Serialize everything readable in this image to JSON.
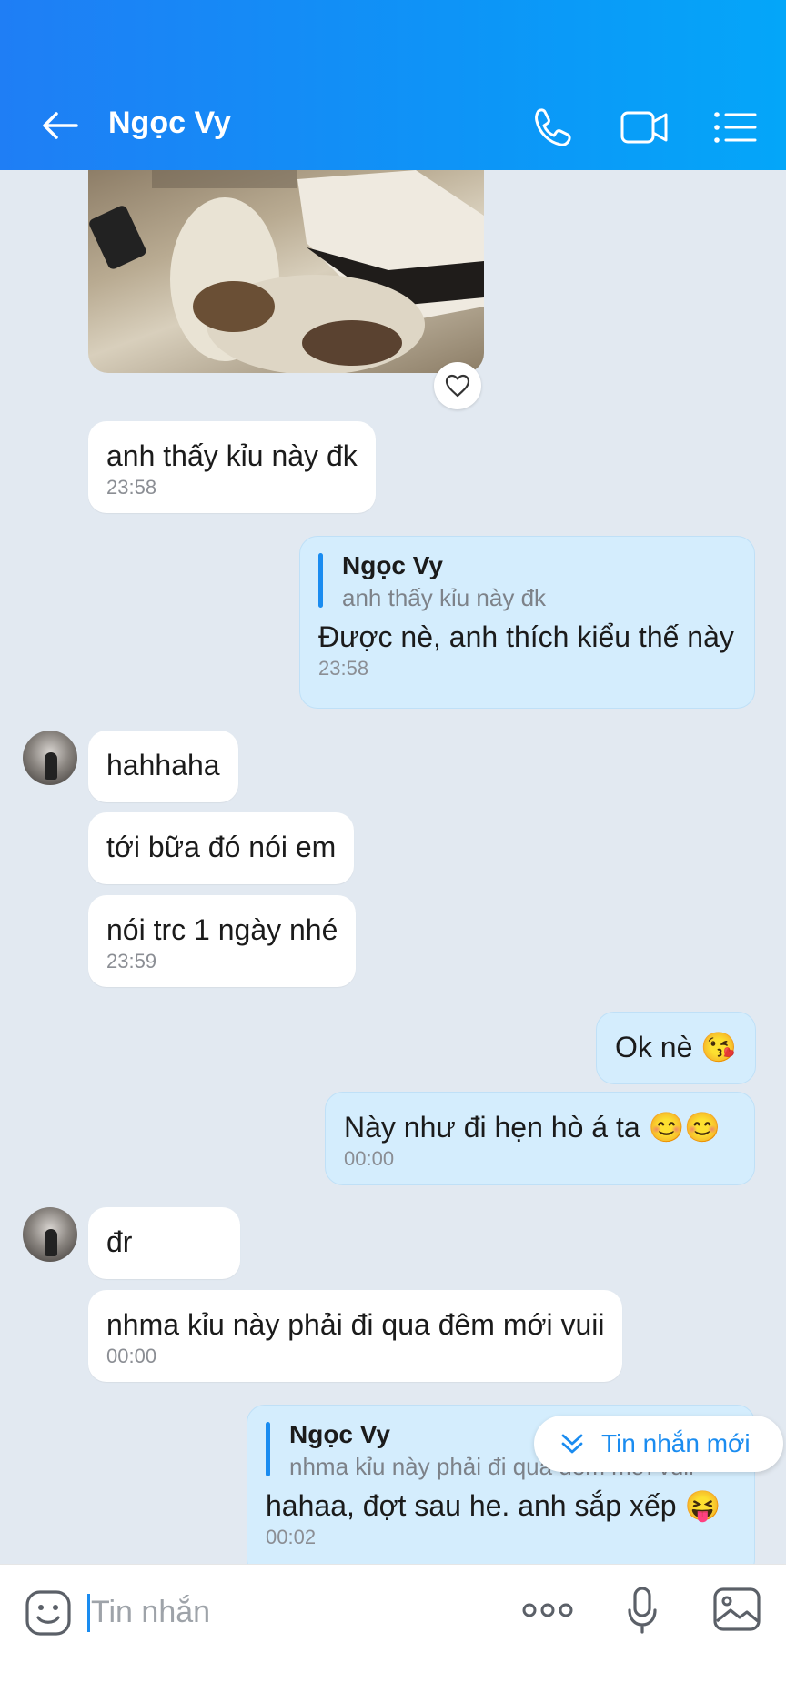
{
  "header": {
    "title": "Ngọc Vy",
    "background_colors": [
      "#1f7ef5",
      "#04a6f9"
    ]
  },
  "messages": {
    "m1": {
      "text": "anh thấy kỉu này đk",
      "time": "23:58"
    },
    "m2": {
      "quote_name": "Ngọc Vy",
      "quote_text": "anh thấy kỉu này đk",
      "text": "Được nè, anh thích kiểu thế này",
      "time": "23:58"
    },
    "m3": {
      "text": "hahhaha"
    },
    "m4": {
      "text": "tới bữa đó nói em"
    },
    "m5": {
      "text": "nói trc 1 ngày nhé",
      "time": "23:59"
    },
    "m6": {
      "text": "Ok nè",
      "emoji": "😘"
    },
    "m7": {
      "text": "Này như đi hẹn hò á ta",
      "emoji": "😊😊",
      "time": "00:00"
    },
    "m8": {
      "text": "đr"
    },
    "m9": {
      "text": "nhma kỉu này phải đi qua đêm mới vuii",
      "time": "00:00"
    },
    "m10": {
      "quote_name": "Ngọc Vy",
      "quote_text": "nhma kỉu này phải đi qua đêm mới vuii",
      "text": "hahaa, đợt sau he. anh sắp xếp",
      "emoji": "😝",
      "time": "00:02"
    }
  },
  "new_messages_button": {
    "label": "Tin nhắn mới"
  },
  "input": {
    "placeholder": "Tin nhắn"
  },
  "colors": {
    "accent": "#1a8cf0",
    "outgoing_bubble": "#d4edfd",
    "chat_background": "#e2e9f1"
  }
}
